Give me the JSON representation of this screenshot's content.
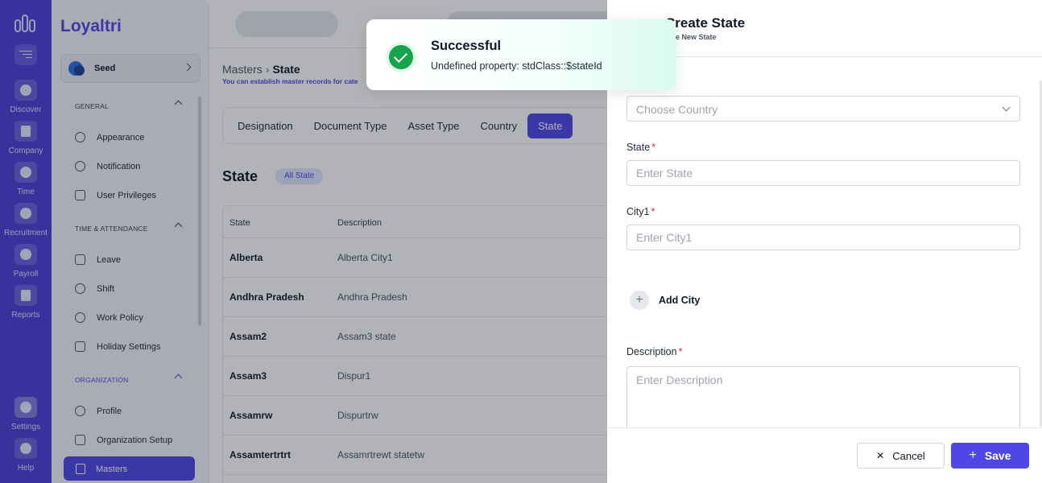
{
  "app": {
    "brand": "Loyaltri",
    "company": "Seed"
  },
  "rail": [
    {
      "label": "Discover",
      "icon": "compass-icon"
    },
    {
      "label": "Company",
      "icon": "building-icon"
    },
    {
      "label": "Time",
      "icon": "clock-icon"
    },
    {
      "label": "Recruitment",
      "icon": "people-icon"
    },
    {
      "label": "Payroll",
      "icon": "dollar-icon"
    },
    {
      "label": "Reports",
      "icon": "report-icon"
    },
    {
      "label": "Settings",
      "icon": "gear-icon"
    },
    {
      "label": "Help",
      "icon": "help-icon"
    }
  ],
  "sidebar": {
    "sections": [
      {
        "title": "GENERAL",
        "items": [
          "Appearance",
          "Notification",
          "User Privileges"
        ]
      },
      {
        "title": "TIME & ATTENDANCE",
        "items": [
          "Leave",
          "Shift",
          "Work Policy",
          "Holiday Settings"
        ]
      },
      {
        "title": "ORGANIZATION",
        "items": [
          "Profile",
          "Organization Setup",
          "Masters"
        ]
      }
    ]
  },
  "main": {
    "breadcrumb": {
      "parent": "Masters",
      "current": "State"
    },
    "subtitle": "You can establish master records for cate",
    "tabs": [
      "Designation",
      "Document Type",
      "Asset Type",
      "Country",
      "State"
    ],
    "active_tab": "State",
    "section_title": "State",
    "badge": "All State",
    "columns": [
      "State",
      "Description"
    ],
    "rows": [
      [
        "Alberta",
        "Alberta City1"
      ],
      [
        "Andhra Pradesh",
        "Andhra Pradesh"
      ],
      [
        "Assam2",
        "Assam3 state"
      ],
      [
        "Assam3",
        "Dispur1"
      ],
      [
        "Assamrw",
        "Dispurtrw"
      ],
      [
        "Assamtertrtrt",
        "Assamrtrewt statetw"
      ]
    ]
  },
  "drawer": {
    "title": "Create State",
    "subtitle": "eate New State",
    "country_placeholder": "Choose Country",
    "state_label": "State",
    "state_placeholder": "Enter State",
    "city_label": "City1",
    "city_placeholder": "Enter City1",
    "add_city": "Add City",
    "description_label": "Description",
    "description_placeholder": "Enter Description",
    "required_mark": "*",
    "cancel": "Cancel",
    "save": "Save"
  },
  "toast": {
    "title": "Successful",
    "message": "Undefined property: stdClass::$stateId",
    "color": "#16a34a"
  },
  "colors": {
    "primary": "#4f46e5",
    "rail": "#4b3fd6",
    "required": "#e11d48"
  }
}
